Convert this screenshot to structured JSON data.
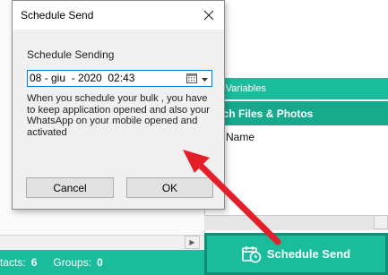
{
  "dialog": {
    "title": "Schedule Send",
    "group_label": "Schedule Sending",
    "date_value": "08 - giu  - 2020  02:43",
    "info_text": "When you schedule your bulk , you have to keep application opened and also your WhatsApp on your mobile opened and activated",
    "cancel_label": "Cancel",
    "ok_label": "OK",
    "close_icon": "close-icon"
  },
  "background": {
    "insert_variables_label": "rt Variables",
    "attach_label": "ach Files & Photos",
    "name_column": "Name",
    "schedule_send_label": "Schedule Send",
    "status": {
      "contacts_label": "tacts:",
      "contacts_value": "6",
      "groups_label": "Groups:",
      "groups_value": "0"
    }
  },
  "colors": {
    "accent": "#1abc9c",
    "accent_dark": "#16a98c",
    "arrow": "#e3202a"
  }
}
